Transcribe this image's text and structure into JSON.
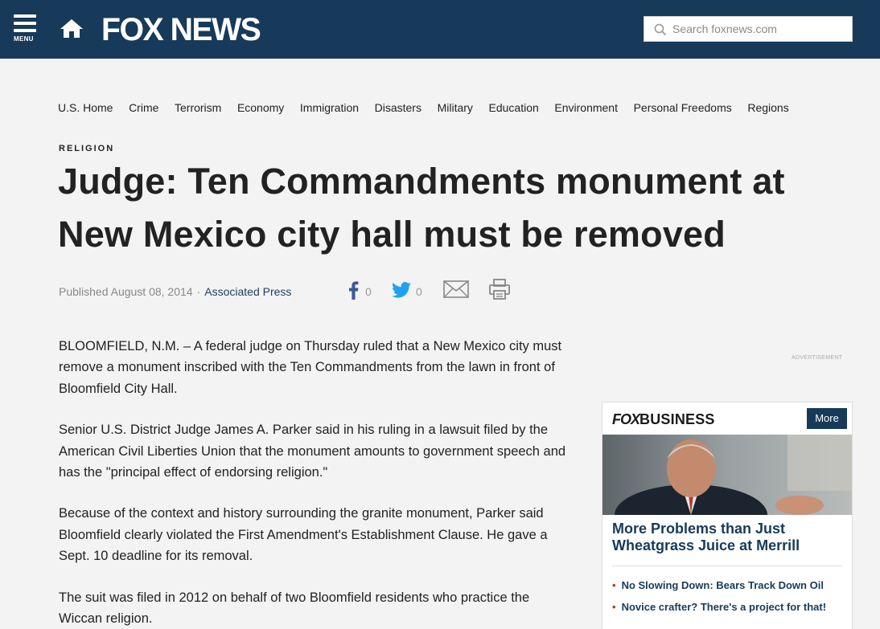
{
  "header": {
    "menu_label": "MENU",
    "logo_text": "FOX NEWS",
    "search": {
      "placeholder": "Search foxnews.com"
    },
    "colors": {
      "bar": "#183a5a"
    }
  },
  "nav": {
    "items": [
      "U.S. Home",
      "Crime",
      "Terrorism",
      "Economy",
      "Immigration",
      "Disasters",
      "Military",
      "Education",
      "Environment",
      "Personal Freedoms",
      "Regions"
    ]
  },
  "article": {
    "kicker": "RELIGION",
    "headline": "Judge: Ten Commandments monument at New Mexico city hall must be removed",
    "published": "Published August 08, 2014",
    "separator": "·",
    "author": "Associated Press",
    "share": {
      "facebook_count": "0",
      "twitter_count": "0"
    },
    "paragraphs": [
      "BLOOMFIELD, N.M. –  A federal judge on Thursday ruled that a New Mexico city must remove a monument inscribed with the Ten Commandments from the lawn in front of Bloomfield City Hall.",
      "Senior U.S. District Judge James A. Parker said in his ruling in a lawsuit filed by the American Civil Liberties Union that the monument amounts to government speech and has the \"principal effect of endorsing religion.\"",
      "Because of the context and history surrounding the granite monument, Parker said Bloomfield clearly violated the First Amendment's Establishment Clause. He gave a Sept. 10 deadline for its removal.",
      "The suit was filed in 2012 on behalf of two Bloomfield residents who practice the Wiccan religion."
    ]
  },
  "sidebar": {
    "ad_label": "ADVERTISEMENT",
    "fox_business": {
      "logo_fox": "FOX",
      "logo_business": "BUSINESS",
      "more_label": "More",
      "headline": "More Problems than Just Wheatgrass Juice at Merrill",
      "links": [
        "No Slowing Down: Bears Track Down Oil",
        "Novice crafter? There's a project for that!"
      ]
    }
  }
}
